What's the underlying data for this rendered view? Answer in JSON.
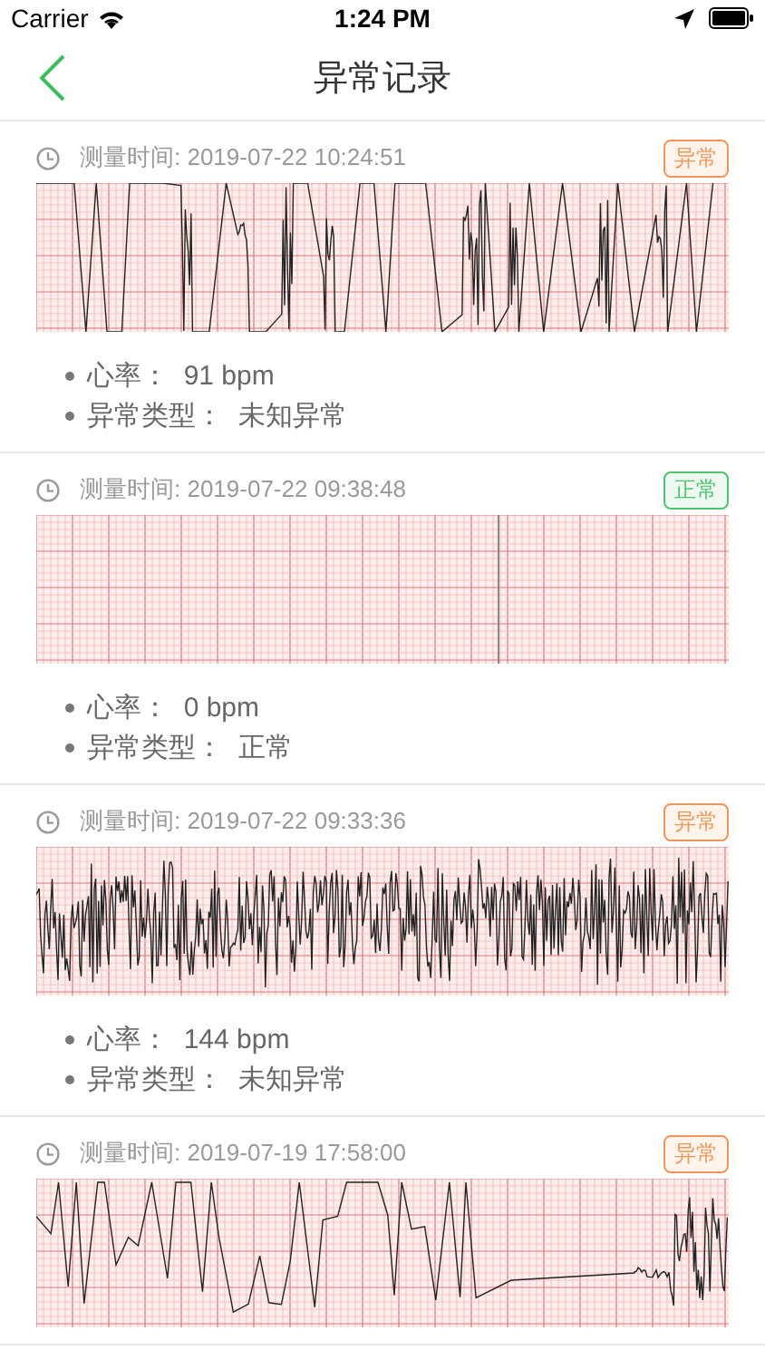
{
  "status_bar": {
    "carrier": "Carrier",
    "time": "1:24 PM"
  },
  "nav": {
    "title": "异常记录"
  },
  "records": [
    {
      "time": "测量时间: 2019-07-22 10:24:51",
      "status": {
        "label": "异常",
        "kind": "abnormal"
      },
      "kind": "spikes",
      "details": [
        "心率：  91 bpm",
        "异常类型：  未知异常"
      ]
    },
    {
      "time": "测量时间: 2019-07-22 09:38:48",
      "status": {
        "label": "正常",
        "kind": "normal"
      },
      "kind": "flat",
      "details": [
        "心率：  0 bpm",
        "异常类型：  正常"
      ]
    },
    {
      "time": "测量时间: 2019-07-22 09:33:36",
      "status": {
        "label": "异常",
        "kind": "abnormal"
      },
      "kind": "noise",
      "details": [
        "心率：  144 bpm",
        "异常类型：  未知异常"
      ]
    },
    {
      "time": "测量时间: 2019-07-19 17:58:00",
      "status": {
        "label": "异常",
        "kind": "abnormal"
      },
      "kind": "mixed"
    }
  ]
}
